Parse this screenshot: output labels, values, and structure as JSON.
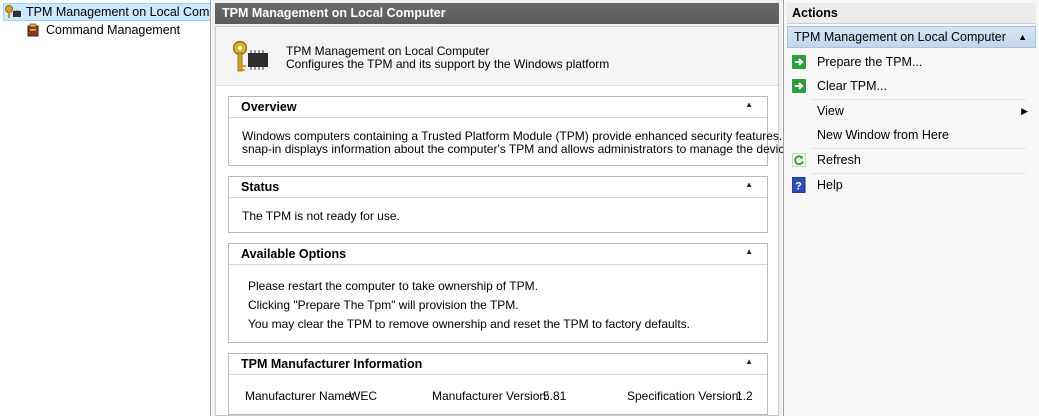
{
  "tree": {
    "root_label": "TPM Management on Local Comp",
    "child_label": "Command Management"
  },
  "center": {
    "header_title": "TPM Management on Local Computer",
    "snapin_title": "TPM Management on Local Computer",
    "snapin_desc": "Configures the TPM and its support by the Windows platform",
    "overview": {
      "title": "Overview",
      "line1": "Windows computers containing a Trusted Platform Module (TPM) provide enhanced security features. This",
      "line2": "snap-in displays information about the computer's TPM and allows administrators to manage the device."
    },
    "status": {
      "title": "Status",
      "text": "The TPM is not ready for use."
    },
    "options": {
      "title": "Available Options",
      "line1": "Please restart the computer to take ownership of TPM.",
      "line2": "Clicking \"Prepare The Tpm\" will provision the TPM.",
      "line3": "You may clear the TPM to remove ownership and reset the TPM to factory defaults."
    },
    "manufacturer": {
      "title": "TPM Manufacturer Information",
      "name_label": "Manufacturer Name:",
      "name_value": "WEC",
      "version_label": "Manufacturer Version:",
      "version_value": "5.81",
      "spec_label": "Specification Version:",
      "spec_value": "1.2"
    }
  },
  "actions": {
    "header": "Actions",
    "group": "TPM Management on Local Computer",
    "items": [
      {
        "label": "Prepare the TPM...",
        "icon": "green-arrow-icon"
      },
      {
        "label": "Clear TPM...",
        "icon": "green-arrow-icon"
      },
      {
        "label": "View",
        "icon": "none"
      },
      {
        "label": "New Window from Here",
        "icon": "none"
      },
      {
        "label": "Refresh",
        "icon": "refresh-icon"
      },
      {
        "label": "Help",
        "icon": "help-icon"
      }
    ]
  },
  "colors": {
    "tree_selection": "#cce8ff",
    "header_dark": "#5a5a5a",
    "actions_group": "#c2d6ec",
    "action_green": "#2e9e3b"
  }
}
